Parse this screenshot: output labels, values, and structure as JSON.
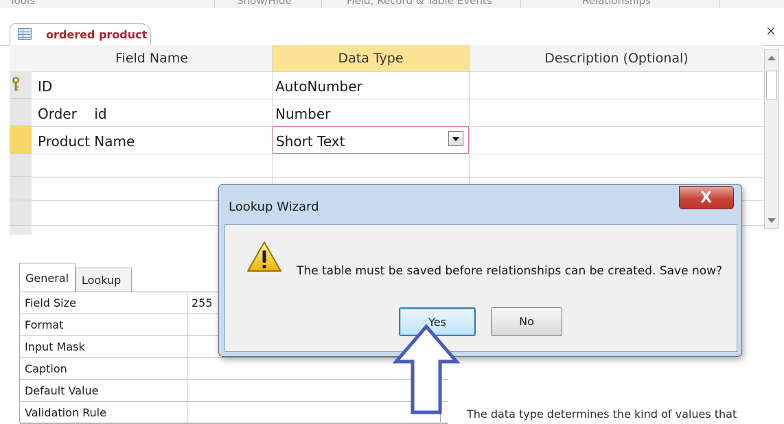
{
  "ribbon": {
    "groups": [
      "Tools",
      "Show/Hide",
      "Field, Record & Table Events",
      "Relationships"
    ]
  },
  "document_tab": {
    "title": "ordered product",
    "close_glyph": "×"
  },
  "design_grid": {
    "headers": [
      "Field Name",
      "Data Type",
      "Description (Optional)"
    ],
    "rows": [
      {
        "field_name": "ID",
        "data_type": "AutoNumber",
        "description": "",
        "primary_key": true
      },
      {
        "field_name": "Order    id",
        "data_type": "Number",
        "description": ""
      },
      {
        "field_name": "Product Name",
        "data_type": "Short Text",
        "description": "",
        "current": true
      }
    ]
  },
  "field_properties": {
    "tabs": [
      "General",
      "Lookup"
    ],
    "active_tab": "General",
    "rows": [
      {
        "label": "Field Size",
        "value": "255"
      },
      {
        "label": "Format",
        "value": ""
      },
      {
        "label": "Input Mask",
        "value": ""
      },
      {
        "label": "Caption",
        "value": ""
      },
      {
        "label": "Default Value",
        "value": ""
      },
      {
        "label": "Validation Rule",
        "value": ""
      }
    ],
    "help_text": "The data type determines the kind of values that"
  },
  "dialog": {
    "title": "Lookup Wizard",
    "close_label": "X",
    "message": "The table must be saved before relationships can be created.  Save now?",
    "yes_label": "Yes",
    "no_label": "No",
    "icon": "warning-icon"
  },
  "colors": {
    "tab_title": "#b0272e",
    "datatype_header": "#fbe393",
    "current_row_selector": "#f9d66a",
    "dialog_frame": "#c8daee",
    "pointer_arrow": "#4a5bb8"
  }
}
